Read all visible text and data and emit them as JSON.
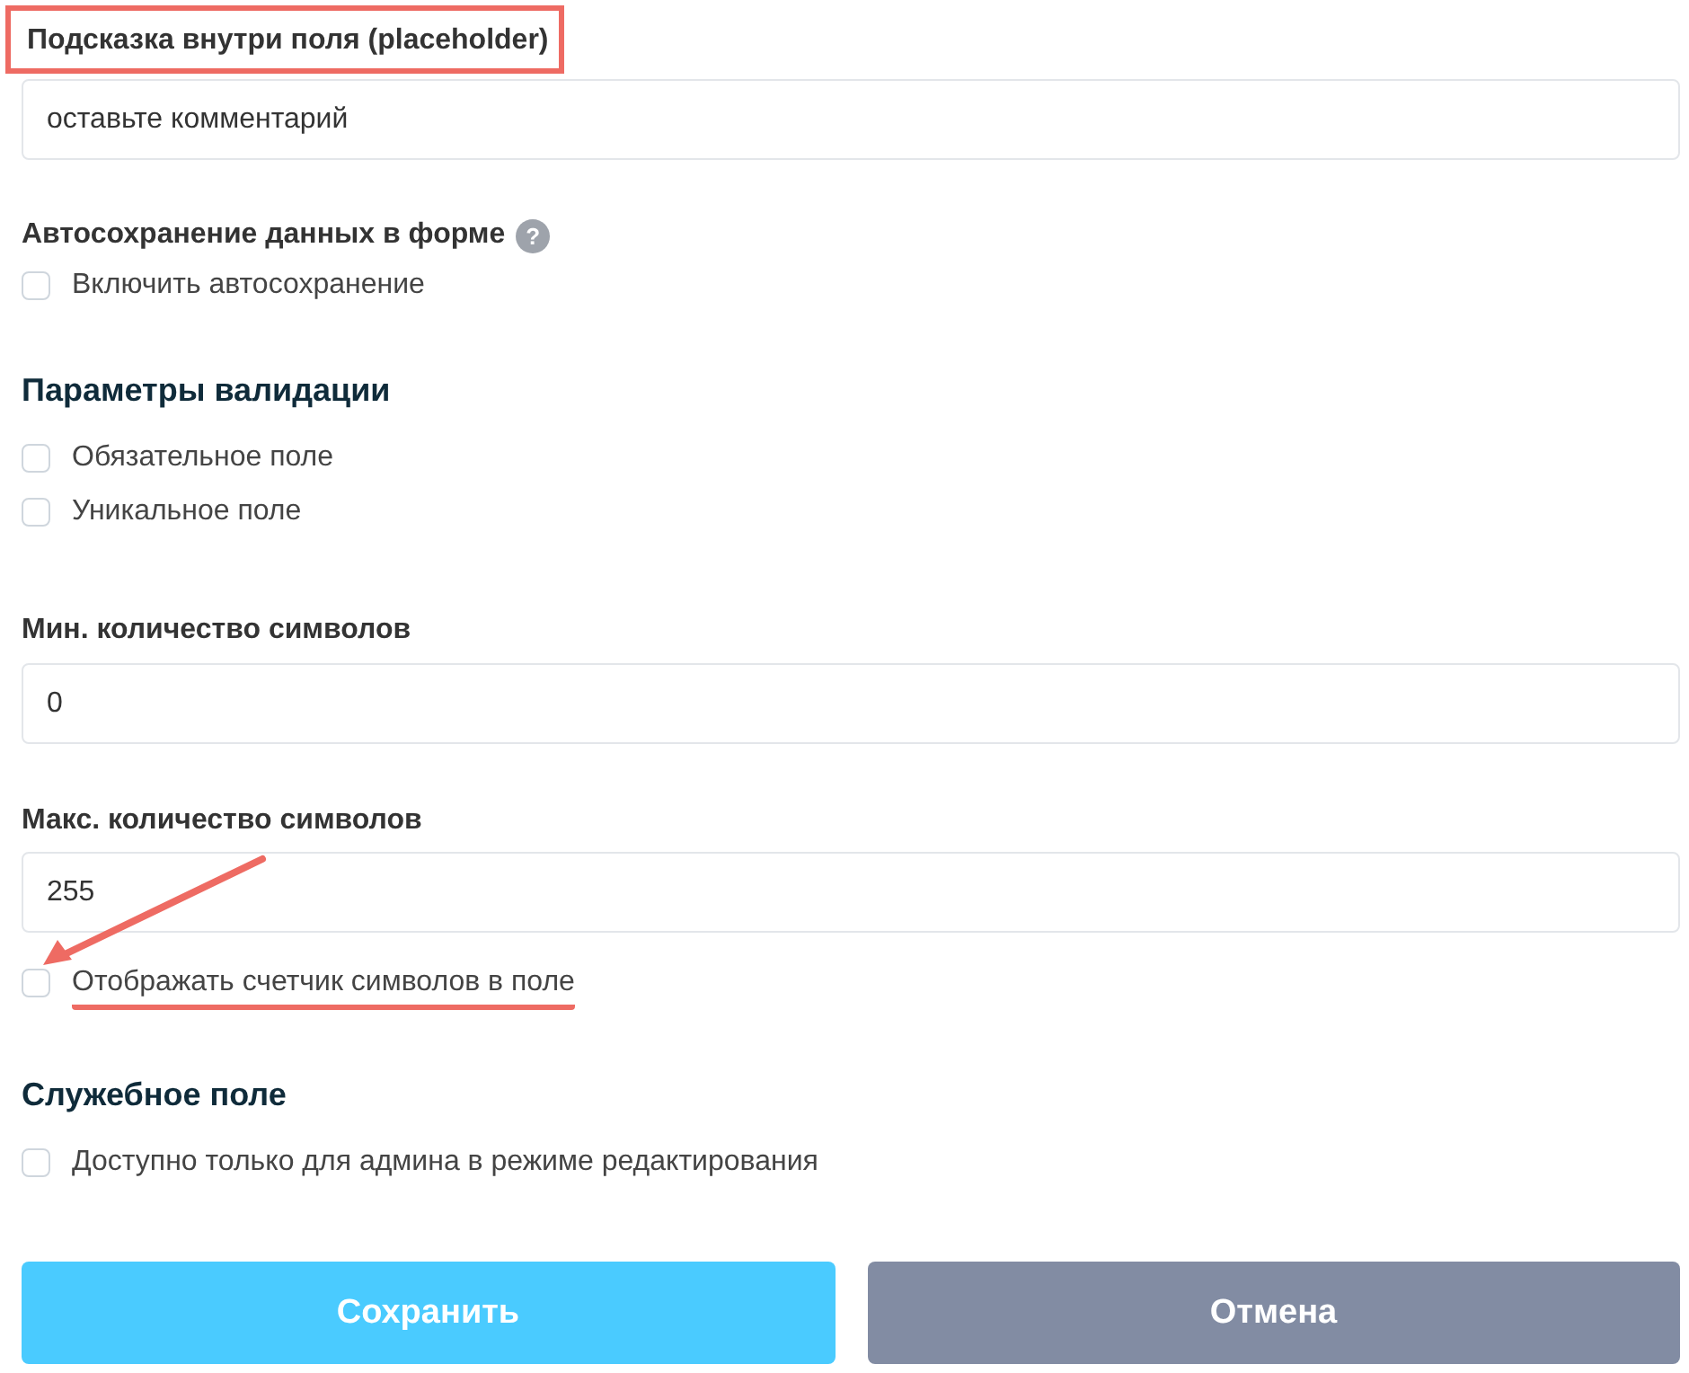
{
  "placeholder_field": {
    "label": "Подсказка внутри поля (placeholder)",
    "highlighted": true,
    "value": "оставьте комментарий"
  },
  "autosave": {
    "title": "Автосохранение данных в форме",
    "help": "?",
    "options": [
      {
        "label": "Включить автосохранение",
        "checked": false,
        "underlined": false,
        "arrow": false
      }
    ]
  },
  "validation": {
    "title": "Параметры валидации",
    "options": [
      {
        "label": "Обязательное поле",
        "checked": false,
        "underlined": false,
        "arrow": false
      },
      {
        "label": "Уникальное поле",
        "checked": false,
        "underlined": false,
        "arrow": false
      }
    ]
  },
  "min_length": {
    "label": "Мин. количество символов",
    "value": "0"
  },
  "max_length": {
    "label": "Макс. количество символов",
    "value": "255"
  },
  "counter_option": {
    "label": "Отображать счетчик символов в поле",
    "checked": false,
    "underlined": true,
    "arrow": true
  },
  "service": {
    "title": "Служебное поле",
    "options": [
      {
        "label": "Доступно только для админа в режиме редактирования",
        "checked": false,
        "underlined": false,
        "arrow": false
      }
    ]
  },
  "buttons": [
    {
      "label": "Сохранить",
      "kind": "primary"
    },
    {
      "label": "Отмена",
      "kind": "secondary"
    }
  ]
}
